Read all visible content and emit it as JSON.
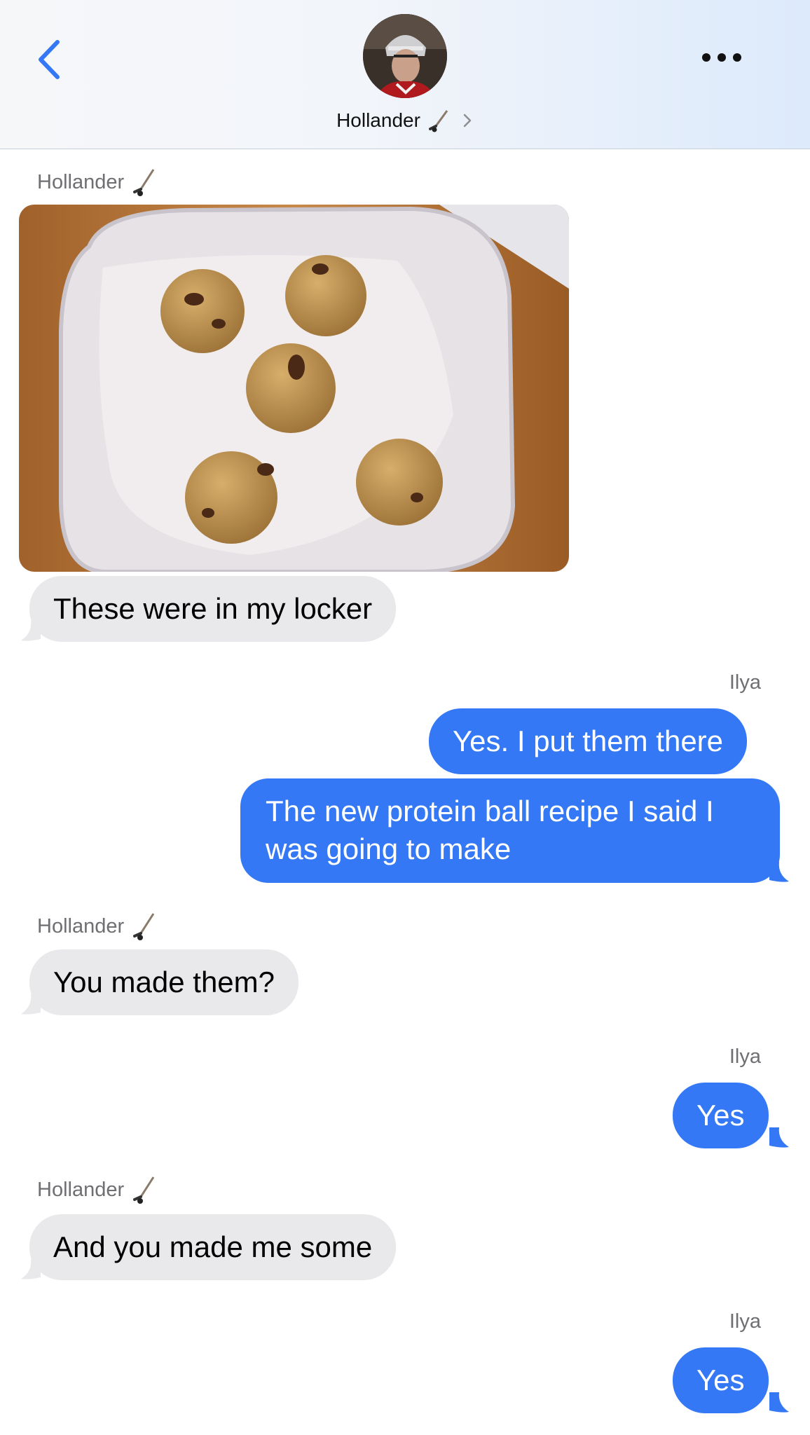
{
  "header": {
    "contact_name": "Hollander",
    "contact_emoji": "hockey-stick-icon",
    "back_icon": "chevron-left-icon",
    "more_icon": "ellipsis-icon",
    "accent": "#3478f6"
  },
  "messages": [
    {
      "sender": "Hollander",
      "direction": "incoming",
      "type": "photo",
      "photo_desc_icon": "protein-balls-photo"
    },
    {
      "sender": "Hollander",
      "direction": "incoming",
      "text": "These were in my locker"
    },
    {
      "sender": "Ilya",
      "direction": "outgoing",
      "text": "Yes. I put them there"
    },
    {
      "sender": "Ilya",
      "direction": "outgoing",
      "text": "The new protein ball recipe I said I was going to make"
    },
    {
      "sender": "Hollander",
      "direction": "incoming",
      "text": "You made them?"
    },
    {
      "sender": "Ilya",
      "direction": "outgoing",
      "text": "Yes"
    },
    {
      "sender": "Hollander",
      "direction": "incoming",
      "text": "And you made me some"
    },
    {
      "sender": "Ilya",
      "direction": "outgoing",
      "text": "Yes"
    }
  ],
  "colors": {
    "incoming_bubble": "#e9e9eb",
    "outgoing_bubble": "#3478f6",
    "sender_label": "#6e6e73"
  }
}
